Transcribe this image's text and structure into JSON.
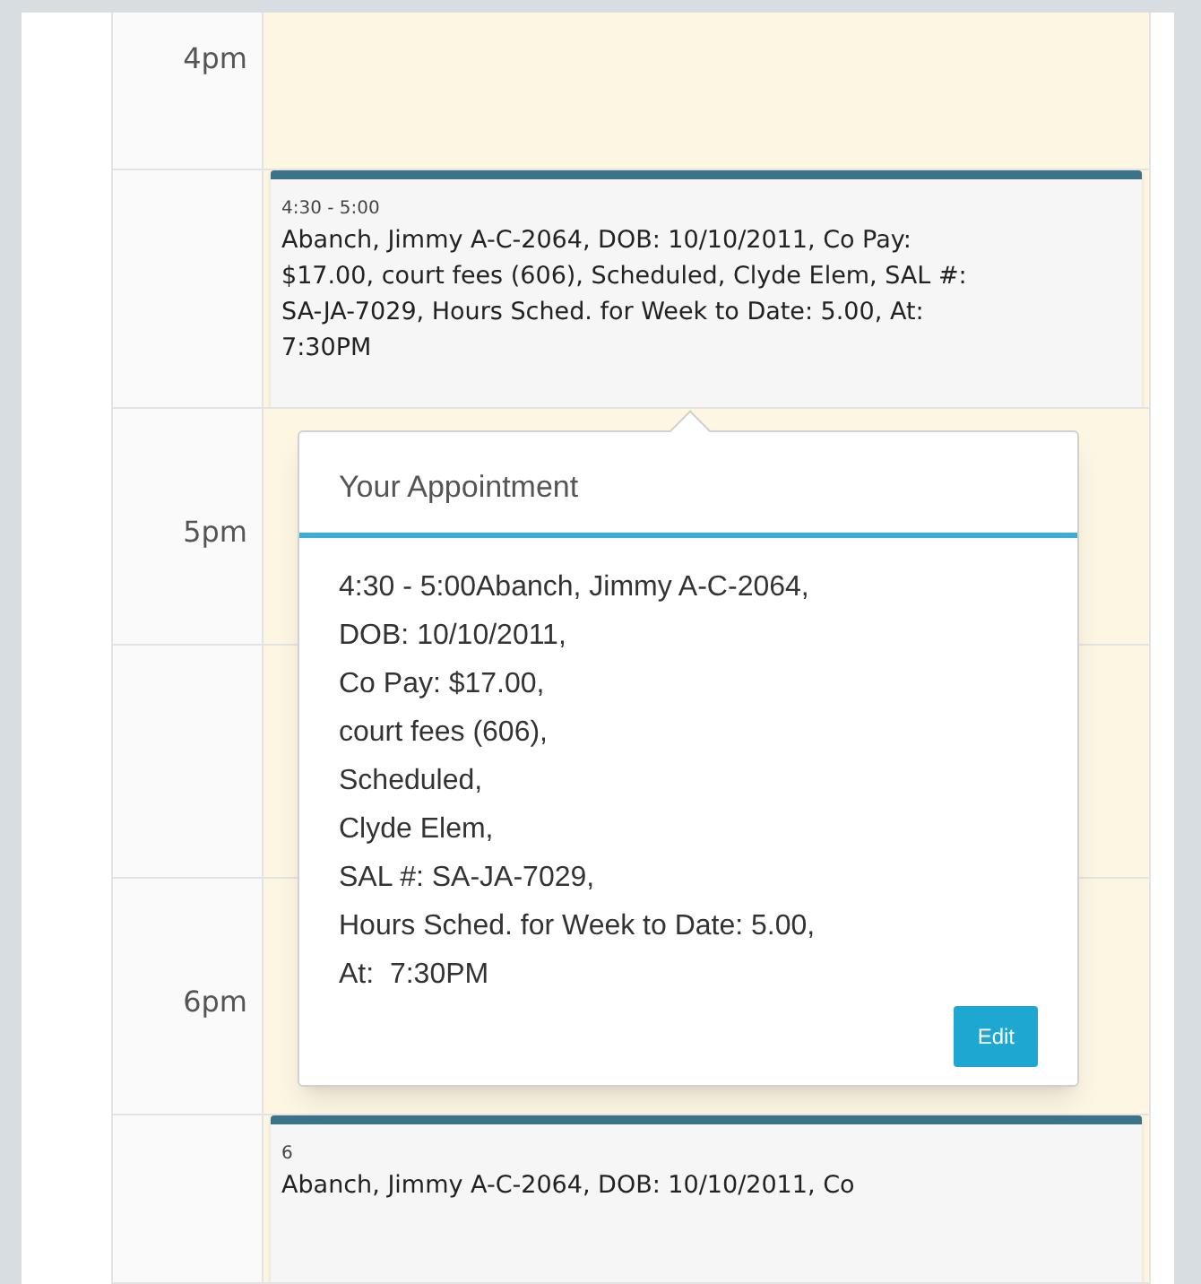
{
  "slots": [
    {
      "kind": "hour",
      "label": "4pm"
    },
    {
      "kind": "half",
      "event": {
        "time": "4:30 - 5:00",
        "text": "Abanch, Jimmy A-C-2064, DOB: 10/10/2011, Co Pay: $17.00, court fees (606), Scheduled, Clyde Elem, SAL #: SA-JA-7029, Hours Sched. for Week to Date: 5.00, At: 7:30PM"
      }
    },
    {
      "kind": "hour",
      "label": "5pm"
    },
    {
      "kind": "half"
    },
    {
      "kind": "hour",
      "label": "6pm"
    },
    {
      "kind": "half",
      "event": {
        "time": "6",
        "text": "Abanch, Jimmy A-C-2064, DOB: 10/10/2011, Co"
      }
    }
  ],
  "popover": {
    "title": "Your Appointment",
    "lines": [
      "4:30 - 5:00Abanch, Jimmy A-C-2064,",
      "DOB: 10/10/2011,",
      "Co Pay: $17.00,",
      "court fees (606),",
      "Scheduled,",
      "Clyde Elem,",
      "SAL #: SA-JA-7029,",
      "Hours Sched. for Week to Date: 5.00,",
      "At:  7:30PM"
    ],
    "button": "Edit"
  }
}
